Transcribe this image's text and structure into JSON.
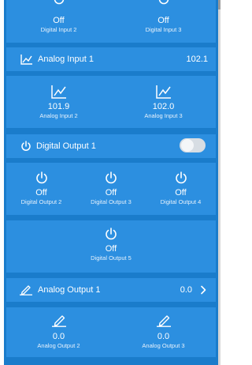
{
  "digital_inputs_top": [
    {
      "value": "Off",
      "label": "Digital Input 2"
    },
    {
      "value": "Off",
      "label": "Digital Input 3"
    }
  ],
  "analog_input_1": {
    "title": "Analog Input 1",
    "value": "102.1"
  },
  "analog_inputs": [
    {
      "value": "101.9",
      "label": "Analog Input 2"
    },
    {
      "value": "102.0",
      "label": "Analog Input 3"
    }
  ],
  "digital_output_1": {
    "title": "Digital Output 1",
    "toggle_on": false
  },
  "digital_outputs": [
    {
      "value": "Off",
      "label": "Digital Output 2"
    },
    {
      "value": "Off",
      "label": "Digital Output 3"
    },
    {
      "value": "Off",
      "label": "Digital Output 4"
    },
    {
      "value": "Off",
      "label": "Digital Output 5"
    }
  ],
  "analog_output_1": {
    "title": "Analog Output 1",
    "value": "0.0"
  },
  "analog_outputs": [
    {
      "value": "0.0",
      "label": "Analog Output 2"
    },
    {
      "value": "0.0",
      "label": "Analog Output 3"
    }
  ],
  "icons": {
    "chart": "line-chart-icon",
    "power": "power-icon",
    "pen": "pen-edit-icon",
    "chevron": "chevron-right-icon",
    "circle_partial": "circle-icon"
  },
  "colors": {
    "background": "#1a7ccb",
    "panel": "#2c8fe0",
    "toggle_track": "#d7dde3"
  }
}
